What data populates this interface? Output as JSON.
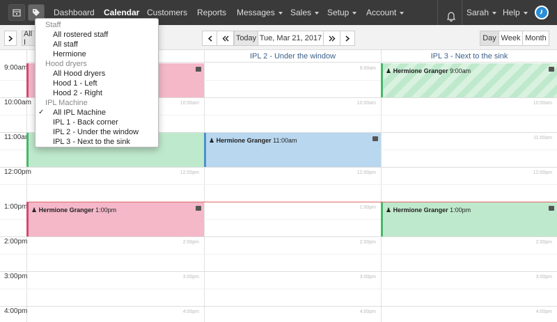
{
  "nav": {
    "items": [
      {
        "label": "Dashboard"
      },
      {
        "label": "Calendar"
      },
      {
        "label": "Customers"
      },
      {
        "label": "Reports"
      },
      {
        "label": "Messages"
      },
      {
        "label": "Sales"
      },
      {
        "label": "Setup"
      },
      {
        "label": "Account"
      }
    ],
    "user": "Sarah",
    "help": "Help"
  },
  "toolbar": {
    "view_prefix": "All I",
    "today": "Today",
    "date": "Tue, Mar 21, 2017",
    "views": [
      "Day",
      "Week",
      "Month"
    ],
    "active_view": "Day"
  },
  "columns": [
    "",
    "IPL 2 - Under the window",
    "IPL 3 - Next to the sink"
  ],
  "times": [
    "9:00am",
    "10:00am",
    "11:00am",
    "12:00pm",
    "1:00pm",
    "2:00pm",
    "3:00pm",
    "4:00pm"
  ],
  "appointments": [
    {
      "client": "Hermione Granger",
      "time": "9:00am",
      "col": 2
    },
    {
      "client": "Hermione Granger",
      "time": "11:00am",
      "col": 1
    },
    {
      "client": "Hermione Granger",
      "time": "1:00pm",
      "col": 0
    },
    {
      "client": "Hermione Granger",
      "time": "1:00pm",
      "col": 2
    }
  ],
  "dropdown": {
    "groups": [
      {
        "label": "Staff",
        "items": [
          "All rostered staff",
          "All staff",
          "Hermione"
        ]
      },
      {
        "label": "Hood dryers",
        "items": [
          "All Hood dryers",
          "Hood 1 - Left",
          "Hood 2 - Right"
        ]
      },
      {
        "label": "IPL Machine",
        "items": [
          "All IPL Machine",
          "IPL 1 - Back corner",
          "IPL 2 - Under the window",
          "IPL 3 - Next to the sink"
        ]
      }
    ],
    "checked": "All IPL Machine"
  },
  "colors": {
    "nav_bg": "#3a3a3a",
    "pink": "#f4b8c9",
    "green": "#bfe9cc",
    "blue": "#b9d7ef",
    "accent": "#2a8fd6"
  }
}
